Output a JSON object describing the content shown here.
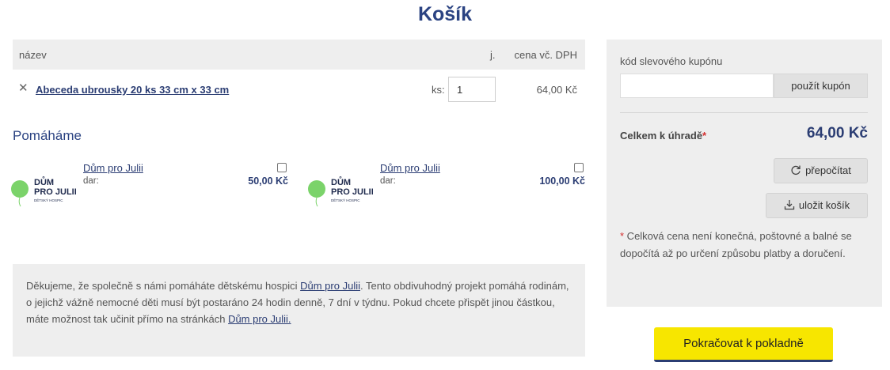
{
  "page": {
    "title": "Košík"
  },
  "cart": {
    "header": {
      "name": "název",
      "unit": "j.",
      "price": "cena vč. DPH"
    },
    "items": [
      {
        "name": "Abeceda ubrousky 20 ks 33 cm x 33 cm",
        "qty_label": "ks:",
        "qty": "1",
        "price": "64,00 Kč"
      }
    ]
  },
  "help": {
    "title": "Pomáháme",
    "donations": [
      {
        "name": "Dům pro Julii",
        "label": "dar:",
        "price": "50,00 Kč",
        "logo_line1": "DŮM",
        "logo_line2": "PRO JULII",
        "logo_sub": "DĚTSKÝ HOSPIC"
      },
      {
        "name": "Dům pro Julii",
        "label": "dar:",
        "price": "100,00 Kč",
        "logo_line1": "DŮM",
        "logo_line2": "PRO JULII",
        "logo_sub": "DĚTSKÝ HOSPIC"
      }
    ]
  },
  "info": {
    "part1": "Děkujeme, že společně s námi pomáháte dětskému hospici ",
    "link1": "Dům pro Julii",
    "part2": ". Tento obdivuhodný projekt pomáhá rodinám, o jejichž vážně nemocné děti musí být  postaráno 24 hodin denně, 7 dní v týdnu. Pokud chcete přispět jinou částkou, máte možnost tak učinit přímo na stránkách ",
    "link2": "Dům pro Julii."
  },
  "sidebar": {
    "coupon_label": "kód slevového kupónu",
    "coupon_value": "",
    "coupon_button": "použít kupón",
    "total_label": "Celkem k úhradě",
    "total_star": "*",
    "total_value": "64,00 Kč",
    "recalc_button": "přepočítat",
    "save_button": "uložit košík",
    "note_star": "*",
    "note": " Celková cena není konečná, poštovné a balné se dopočítá až po určení způsobu platby a doručení."
  },
  "checkout_button": "Pokračovat k pokladně",
  "icons": {
    "remove": "close-icon",
    "recalc": "refresh-icon",
    "save": "download-icon",
    "logo": "balloon-icon"
  },
  "colors": {
    "accent": "#2b4382",
    "checkout": "#f7e600",
    "panel": "#eeeeee",
    "logo_green": "#7bd36a"
  }
}
